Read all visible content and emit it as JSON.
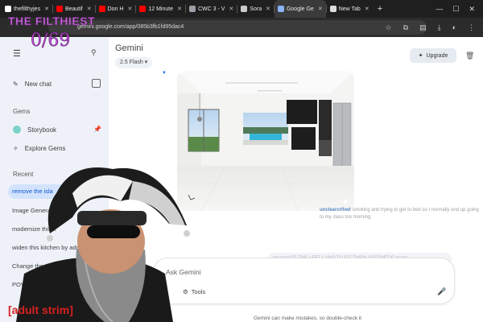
{
  "browser": {
    "tabs": [
      {
        "label": "thefilthyjes",
        "icon": "tiktok-icon",
        "color": "#ffffff",
        "active": false
      },
      {
        "label": "Beautif",
        "icon": "youtube-icon",
        "color": "#ff0000",
        "active": false
      },
      {
        "label": "Don H",
        "icon": "youtube-icon",
        "color": "#ff0000",
        "active": false
      },
      {
        "label": "12 Minute",
        "icon": "youtube-icon",
        "color": "#ff0000",
        "active": false
      },
      {
        "label": "CWC 3 - V",
        "icon": "doc-icon",
        "color": "#9aa0a6",
        "active": false
      },
      {
        "label": "Sora",
        "icon": "sora-icon",
        "color": "#cccccc",
        "active": false
      },
      {
        "label": "Google Ge",
        "icon": "gemini-icon",
        "color": "#8ab4f8",
        "active": true
      },
      {
        "label": "New Tab",
        "icon": "chrome-icon",
        "color": "#dddddd",
        "active": false
      }
    ],
    "url": "gemini.google.com/app/085b3fb1fd95dac4"
  },
  "sidebar": {
    "new_chat": "New chat",
    "gems_heading": "Gems",
    "gems": [
      {
        "label": "Storybook"
      },
      {
        "label": "Explore Gems"
      }
    ],
    "recent_heading": "Recent",
    "recent": [
      {
        "label": "remove the isla",
        "selected": true
      },
      {
        "label": "Image Genera",
        "selected": false
      },
      {
        "label": "modernize this k",
        "selected": false
      },
      {
        "label": "widen this kitchen by add",
        "selected": false
      },
      {
        "label": "Change the perso",
        "selected": false
      },
      {
        "label": "POV: C",
        "selected": false
      }
    ]
  },
  "main": {
    "title": "Gemini",
    "model": "2.5 Flash",
    "upgrade_label": "Upgrade",
    "chat_handle": "unclearcr0wd",
    "chat_message": "smoking and trying to get to bed so I normally end up going to my class too morning",
    "faded_message": "modernIZE THE LEFT LAMP TO FIT THEM AESTHETIC make",
    "input_placeholder": "Ask Gemini",
    "tools_label": "Tools",
    "disclaimer": "Gemini can make mistakes, so double-check it"
  },
  "overlay": {
    "title": "THE FILTHIEST",
    "count": "0/69",
    "adult_label": "[adult strim]"
  }
}
